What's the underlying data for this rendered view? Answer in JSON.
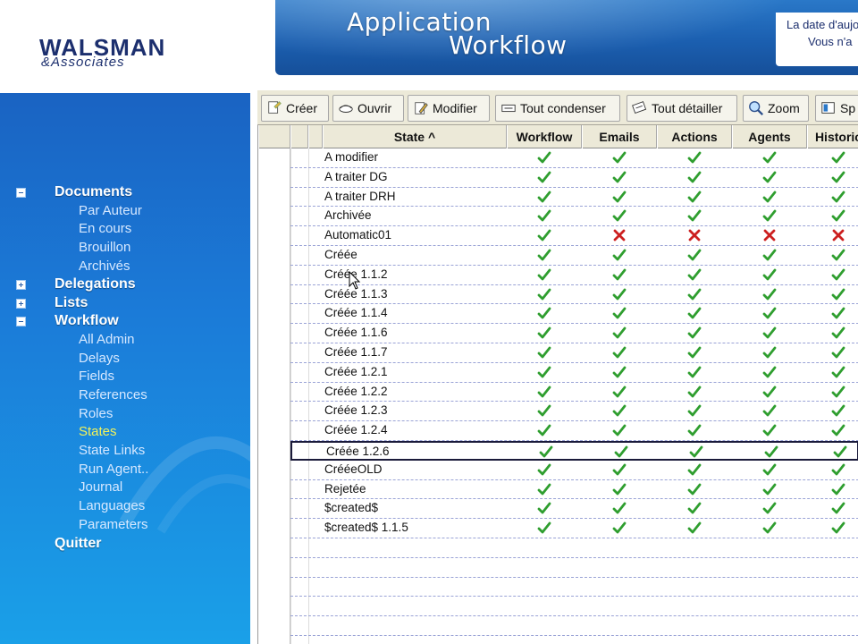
{
  "logo": {
    "main": "WALSMAN",
    "sub": "&Associates"
  },
  "header": {
    "title_line1": "Application",
    "title_line2": "Workflow",
    "date_line1": "La date d'aujo",
    "date_line2": "Vous n'a"
  },
  "sidebar": {
    "sections": [
      {
        "label": "Documents",
        "expander": "minus",
        "items": [
          "Par Auteur",
          "En cours",
          "Brouillon",
          "Archivés"
        ]
      },
      {
        "label": "Delegations",
        "expander": "plus",
        "items": []
      },
      {
        "label": "Lists",
        "expander": "plus",
        "items": []
      },
      {
        "label": "Workflow",
        "expander": "minus",
        "items": [
          "All Admin",
          "Delays",
          "Fields",
          "References",
          "Roles",
          "States",
          "State Links",
          "Run Agent..",
          "Journal",
          "Languages",
          "Parameters"
        ]
      },
      {
        "label": "Quitter",
        "expander": "none",
        "items": []
      }
    ],
    "active_item": "States"
  },
  "toolbar": {
    "buttons": [
      {
        "label": "Créer",
        "icon": "create-icon"
      },
      {
        "label": "Ouvrir",
        "icon": "open-icon"
      },
      {
        "label": "Modifier",
        "icon": "edit-icon"
      },
      {
        "label": "Tout condenser",
        "icon": "collapse-all-icon"
      },
      {
        "label": "Tout détailler",
        "icon": "expand-all-icon"
      },
      {
        "label": "Zoom",
        "icon": "zoom-icon"
      },
      {
        "label": "Sp",
        "icon": "split-icon"
      }
    ]
  },
  "grid": {
    "columns": [
      "State ^",
      "Workflow",
      "Emails",
      "Actions",
      "Agents",
      "Historic"
    ],
    "sort_column": "State",
    "rows": [
      {
        "state": "A modifier",
        "flags": [
          true,
          true,
          true,
          true,
          true
        ]
      },
      {
        "state": "A traiter DG",
        "flags": [
          true,
          true,
          true,
          true,
          true
        ]
      },
      {
        "state": "A traiter DRH",
        "flags": [
          true,
          true,
          true,
          true,
          true
        ]
      },
      {
        "state": "Archivée",
        "flags": [
          true,
          true,
          true,
          true,
          true
        ]
      },
      {
        "state": "Automatic01",
        "flags": [
          true,
          false,
          false,
          false,
          false
        ]
      },
      {
        "state": "Créée",
        "flags": [
          true,
          true,
          true,
          true,
          true
        ]
      },
      {
        "state": "Créée 1.1.2",
        "flags": [
          true,
          true,
          true,
          true,
          true
        ]
      },
      {
        "state": "Créée 1.1.3",
        "flags": [
          true,
          true,
          true,
          true,
          true
        ]
      },
      {
        "state": "Créée 1.1.4",
        "flags": [
          true,
          true,
          true,
          true,
          true
        ]
      },
      {
        "state": "Créée 1.1.6",
        "flags": [
          true,
          true,
          true,
          true,
          true
        ]
      },
      {
        "state": "Créée 1.1.7",
        "flags": [
          true,
          true,
          true,
          true,
          true
        ]
      },
      {
        "state": "Créée 1.2.1",
        "flags": [
          true,
          true,
          true,
          true,
          true
        ]
      },
      {
        "state": "Créée 1.2.2",
        "flags": [
          true,
          true,
          true,
          true,
          true
        ]
      },
      {
        "state": "Créée 1.2.3",
        "flags": [
          true,
          true,
          true,
          true,
          true
        ]
      },
      {
        "state": "Créée 1.2.4",
        "flags": [
          true,
          true,
          true,
          true,
          true
        ]
      },
      {
        "state": "Créée 1.2.6",
        "flags": [
          true,
          true,
          true,
          true,
          true
        ]
      },
      {
        "state": "CrééeOLD",
        "flags": [
          true,
          true,
          true,
          true,
          true
        ]
      },
      {
        "state": "Rejetée",
        "flags": [
          true,
          true,
          true,
          true,
          true
        ]
      },
      {
        "state": "$created$",
        "flags": [
          true,
          true,
          true,
          true,
          true
        ]
      },
      {
        "state": "$created$ 1.1.5",
        "flags": [
          true,
          true,
          true,
          true,
          true
        ]
      }
    ],
    "selected_row": "Créée 1.2.6"
  },
  "colors": {
    "check": "#2f9e2f",
    "cross": "#cc1f1f",
    "active_nav": "#f2f25a",
    "banner": "#1b5fb0"
  }
}
